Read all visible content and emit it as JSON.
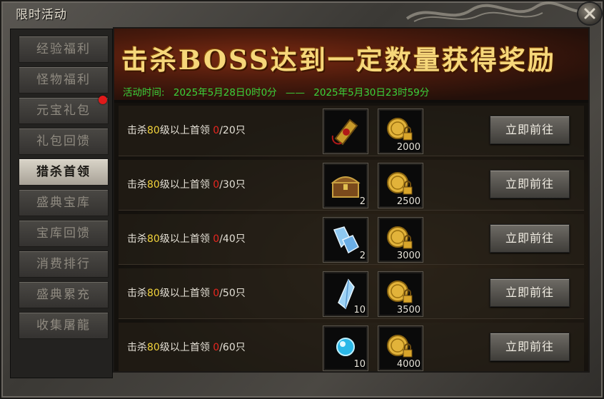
{
  "window": {
    "title": "限时活动"
  },
  "sidebar": {
    "items": [
      {
        "label": "经验福利",
        "active": false
      },
      {
        "label": "怪物福利",
        "active": false
      },
      {
        "label": "元宝礼包",
        "active": false,
        "badge": true
      },
      {
        "label": "礼包回馈",
        "active": false
      },
      {
        "label": "猎杀首领",
        "active": true
      },
      {
        "label": "盛典宝库",
        "active": false
      },
      {
        "label": "宝库回馈",
        "active": false
      },
      {
        "label": "消费排行",
        "active": false
      },
      {
        "label": "盛典累充",
        "active": false
      },
      {
        "label": "收集屠龍",
        "active": false
      }
    ]
  },
  "banner": {
    "title": "击杀BOSS达到一定数量获得奖励",
    "time_label": "活动时间:",
    "start": "2025年5月28日0时0分",
    "separator": "——",
    "end": "2025年5月30日23时59分"
  },
  "tasks": [
    {
      "prefix": "击杀",
      "level": "80",
      "mid": "级以上首领 ",
      "current": "0",
      "target": "/20只",
      "item": {
        "icon": "gold-gem-frame-icon",
        "count": ""
      },
      "coin": {
        "icon": "locked-gold-coin-icon",
        "count": "2000"
      },
      "button": "立即前往"
    },
    {
      "prefix": "击杀",
      "level": "80",
      "mid": "级以上首领 ",
      "current": "0",
      "target": "/30只",
      "item": {
        "icon": "treasure-chest-icon",
        "count": "2"
      },
      "coin": {
        "icon": "locked-gold-coin-icon",
        "count": "2500"
      },
      "button": "立即前往"
    },
    {
      "prefix": "击杀",
      "level": "80",
      "mid": "级以上首领 ",
      "current": "0",
      "target": "/40只",
      "item": {
        "icon": "crystal-cluster-icon",
        "count": "2"
      },
      "coin": {
        "icon": "locked-gold-coin-icon",
        "count": "3000"
      },
      "button": "立即前往"
    },
    {
      "prefix": "击杀",
      "level": "80",
      "mid": "级以上首领 ",
      "current": "0",
      "target": "/50只",
      "item": {
        "icon": "crystal-shard-icon",
        "count": "10"
      },
      "coin": {
        "icon": "locked-gold-coin-icon",
        "count": "3500"
      },
      "button": "立即前往"
    },
    {
      "prefix": "击杀",
      "level": "80",
      "mid": "级以上首领 ",
      "current": "0",
      "target": "/60只",
      "item": {
        "icon": "blue-orb-icon",
        "count": "10"
      },
      "coin": {
        "icon": "locked-gold-coin-icon",
        "count": "4000"
      },
      "button": "立即前往"
    }
  ],
  "colors": {
    "time_green": "#3bd23b",
    "level_yellow": "#f2d33c",
    "progress_red": "#e8261f",
    "banner_gold": "#f6d77a"
  }
}
